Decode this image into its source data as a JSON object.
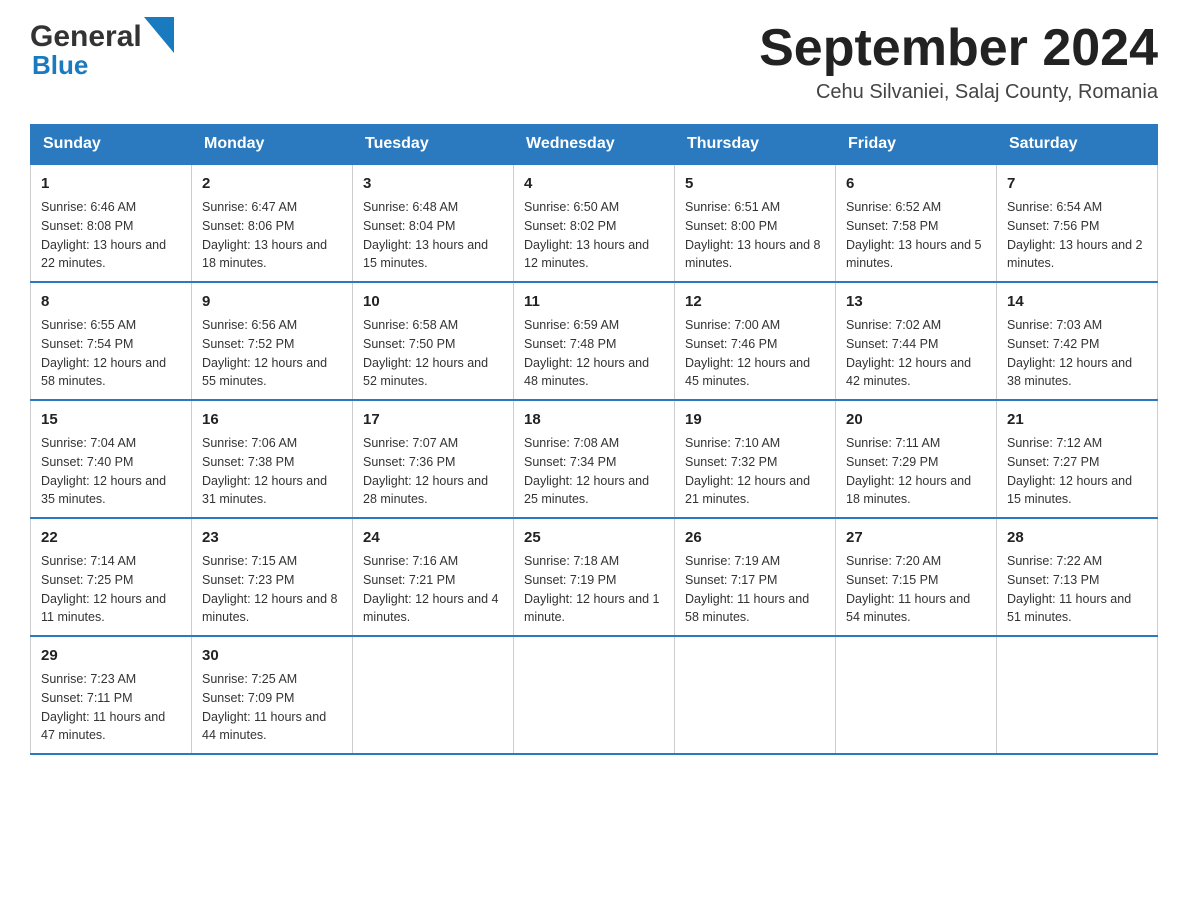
{
  "header": {
    "month_title": "September 2024",
    "location": "Cehu Silvaniei, Salaj County, Romania",
    "logo_general": "General",
    "logo_blue": "Blue"
  },
  "days_of_week": [
    "Sunday",
    "Monday",
    "Tuesday",
    "Wednesday",
    "Thursday",
    "Friday",
    "Saturday"
  ],
  "weeks": [
    [
      {
        "day": "1",
        "sunrise": "6:46 AM",
        "sunset": "8:08 PM",
        "daylight": "13 hours and 22 minutes."
      },
      {
        "day": "2",
        "sunrise": "6:47 AM",
        "sunset": "8:06 PM",
        "daylight": "13 hours and 18 minutes."
      },
      {
        "day": "3",
        "sunrise": "6:48 AM",
        "sunset": "8:04 PM",
        "daylight": "13 hours and 15 minutes."
      },
      {
        "day": "4",
        "sunrise": "6:50 AM",
        "sunset": "8:02 PM",
        "daylight": "13 hours and 12 minutes."
      },
      {
        "day": "5",
        "sunrise": "6:51 AM",
        "sunset": "8:00 PM",
        "daylight": "13 hours and 8 minutes."
      },
      {
        "day": "6",
        "sunrise": "6:52 AM",
        "sunset": "7:58 PM",
        "daylight": "13 hours and 5 minutes."
      },
      {
        "day": "7",
        "sunrise": "6:54 AM",
        "sunset": "7:56 PM",
        "daylight": "13 hours and 2 minutes."
      }
    ],
    [
      {
        "day": "8",
        "sunrise": "6:55 AM",
        "sunset": "7:54 PM",
        "daylight": "12 hours and 58 minutes."
      },
      {
        "day": "9",
        "sunrise": "6:56 AM",
        "sunset": "7:52 PM",
        "daylight": "12 hours and 55 minutes."
      },
      {
        "day": "10",
        "sunrise": "6:58 AM",
        "sunset": "7:50 PM",
        "daylight": "12 hours and 52 minutes."
      },
      {
        "day": "11",
        "sunrise": "6:59 AM",
        "sunset": "7:48 PM",
        "daylight": "12 hours and 48 minutes."
      },
      {
        "day": "12",
        "sunrise": "7:00 AM",
        "sunset": "7:46 PM",
        "daylight": "12 hours and 45 minutes."
      },
      {
        "day": "13",
        "sunrise": "7:02 AM",
        "sunset": "7:44 PM",
        "daylight": "12 hours and 42 minutes."
      },
      {
        "day": "14",
        "sunrise": "7:03 AM",
        "sunset": "7:42 PM",
        "daylight": "12 hours and 38 minutes."
      }
    ],
    [
      {
        "day": "15",
        "sunrise": "7:04 AM",
        "sunset": "7:40 PM",
        "daylight": "12 hours and 35 minutes."
      },
      {
        "day": "16",
        "sunrise": "7:06 AM",
        "sunset": "7:38 PM",
        "daylight": "12 hours and 31 minutes."
      },
      {
        "day": "17",
        "sunrise": "7:07 AM",
        "sunset": "7:36 PM",
        "daylight": "12 hours and 28 minutes."
      },
      {
        "day": "18",
        "sunrise": "7:08 AM",
        "sunset": "7:34 PM",
        "daylight": "12 hours and 25 minutes."
      },
      {
        "day": "19",
        "sunrise": "7:10 AM",
        "sunset": "7:32 PM",
        "daylight": "12 hours and 21 minutes."
      },
      {
        "day": "20",
        "sunrise": "7:11 AM",
        "sunset": "7:29 PM",
        "daylight": "12 hours and 18 minutes."
      },
      {
        "day": "21",
        "sunrise": "7:12 AM",
        "sunset": "7:27 PM",
        "daylight": "12 hours and 15 minutes."
      }
    ],
    [
      {
        "day": "22",
        "sunrise": "7:14 AM",
        "sunset": "7:25 PM",
        "daylight": "12 hours and 11 minutes."
      },
      {
        "day": "23",
        "sunrise": "7:15 AM",
        "sunset": "7:23 PM",
        "daylight": "12 hours and 8 minutes."
      },
      {
        "day": "24",
        "sunrise": "7:16 AM",
        "sunset": "7:21 PM",
        "daylight": "12 hours and 4 minutes."
      },
      {
        "day": "25",
        "sunrise": "7:18 AM",
        "sunset": "7:19 PM",
        "daylight": "12 hours and 1 minute."
      },
      {
        "day": "26",
        "sunrise": "7:19 AM",
        "sunset": "7:17 PM",
        "daylight": "11 hours and 58 minutes."
      },
      {
        "day": "27",
        "sunrise": "7:20 AM",
        "sunset": "7:15 PM",
        "daylight": "11 hours and 54 minutes."
      },
      {
        "day": "28",
        "sunrise": "7:22 AM",
        "sunset": "7:13 PM",
        "daylight": "11 hours and 51 minutes."
      }
    ],
    [
      {
        "day": "29",
        "sunrise": "7:23 AM",
        "sunset": "7:11 PM",
        "daylight": "11 hours and 47 minutes."
      },
      {
        "day": "30",
        "sunrise": "7:25 AM",
        "sunset": "7:09 PM",
        "daylight": "11 hours and 44 minutes."
      },
      null,
      null,
      null,
      null,
      null
    ]
  ]
}
